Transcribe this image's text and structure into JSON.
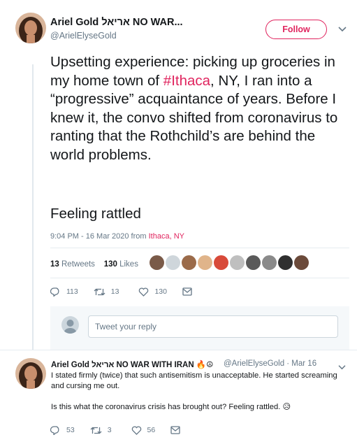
{
  "main_tweet": {
    "author_name": "Ariel Gold אריאל NO WAR...",
    "author_handle": "@ArielElyseGold",
    "follow_label": "Follow",
    "text_before_hashtag": "Upsetting experience: picking up groceries in my home town of ",
    "hashtag": "#Ithaca",
    "text_after_hashtag": ", NY, I ran into a “progressive” acquaintance of years. Before I knew it, the convo shifted from coronavirus to ranting that the Rothchild’s are behind the world problems.",
    "text_second_para": "Feeling rattled",
    "timestamp": "9:04 PM - 16 Mar 2020 from",
    "location": "Ithaca, NY",
    "retweets_count": "13",
    "retweets_label": "Retweets",
    "likes_count": "130",
    "likes_label": "Likes",
    "liker_avatar_count": 10,
    "actions": {
      "replies": "113",
      "retweets": "13",
      "likes": "130"
    }
  },
  "reply_box": {
    "placeholder": "Tweet your reply"
  },
  "reply_tweet": {
    "author_name": "Ariel Gold אריאל NO WAR WITH IRAN 🔥☮",
    "author_handle": "@ArielElyseGold · Mar 16",
    "text_line1": "I stated firmly (twice) that such antisemitism is unacceptable. He started screaming and cursing me out.",
    "text_line2": "Is this what the coronavirus crisis has brought out? Feeling rattled. 😥",
    "actions": {
      "replies": "53",
      "retweets": "3",
      "likes": "56"
    }
  },
  "colors": {
    "accent": "#e0245e",
    "muted": "#657786",
    "text": "#14171a",
    "border": "#e6ecf0"
  },
  "icons": [
    "reply-icon",
    "retweet-icon",
    "like-icon",
    "message-icon",
    "chevron-down-icon"
  ]
}
